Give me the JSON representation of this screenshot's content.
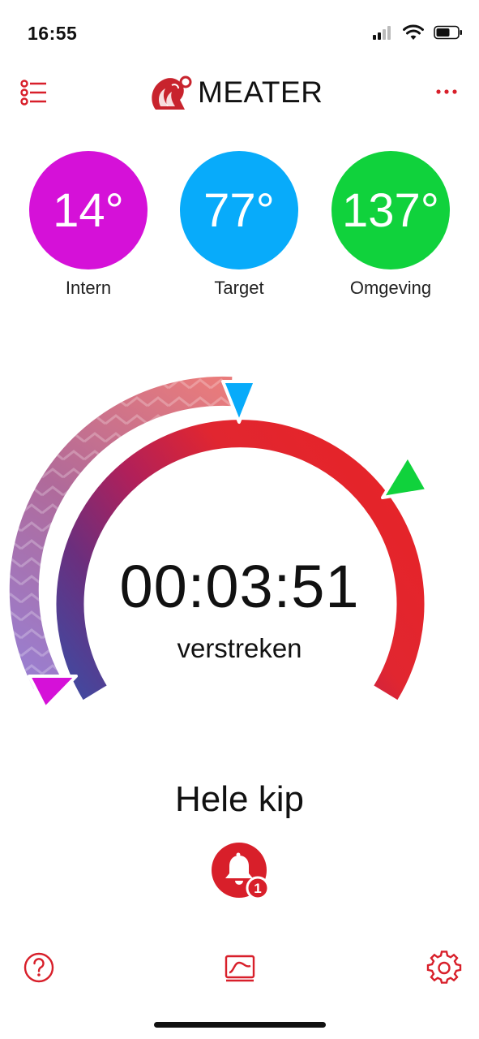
{
  "status_bar": {
    "time": "16:55"
  },
  "header": {
    "brand": "MEATER"
  },
  "temperatures": [
    {
      "value": "14°",
      "label": "Intern",
      "color": "#d511d8"
    },
    {
      "value": "77°",
      "label": "Target",
      "color": "#08abfa"
    },
    {
      "value": "137°",
      "label": "Omgeving",
      "color": "#10d23c"
    }
  ],
  "timer": {
    "elapsed": "00:03:51",
    "label": "verstreken"
  },
  "cook": {
    "name": "Hele kip"
  },
  "alerts": {
    "count": "1",
    "accent": "#d81f2a"
  },
  "tabbar": {
    "items": [
      "help-icon",
      "graph-icon",
      "gear-icon"
    ]
  }
}
